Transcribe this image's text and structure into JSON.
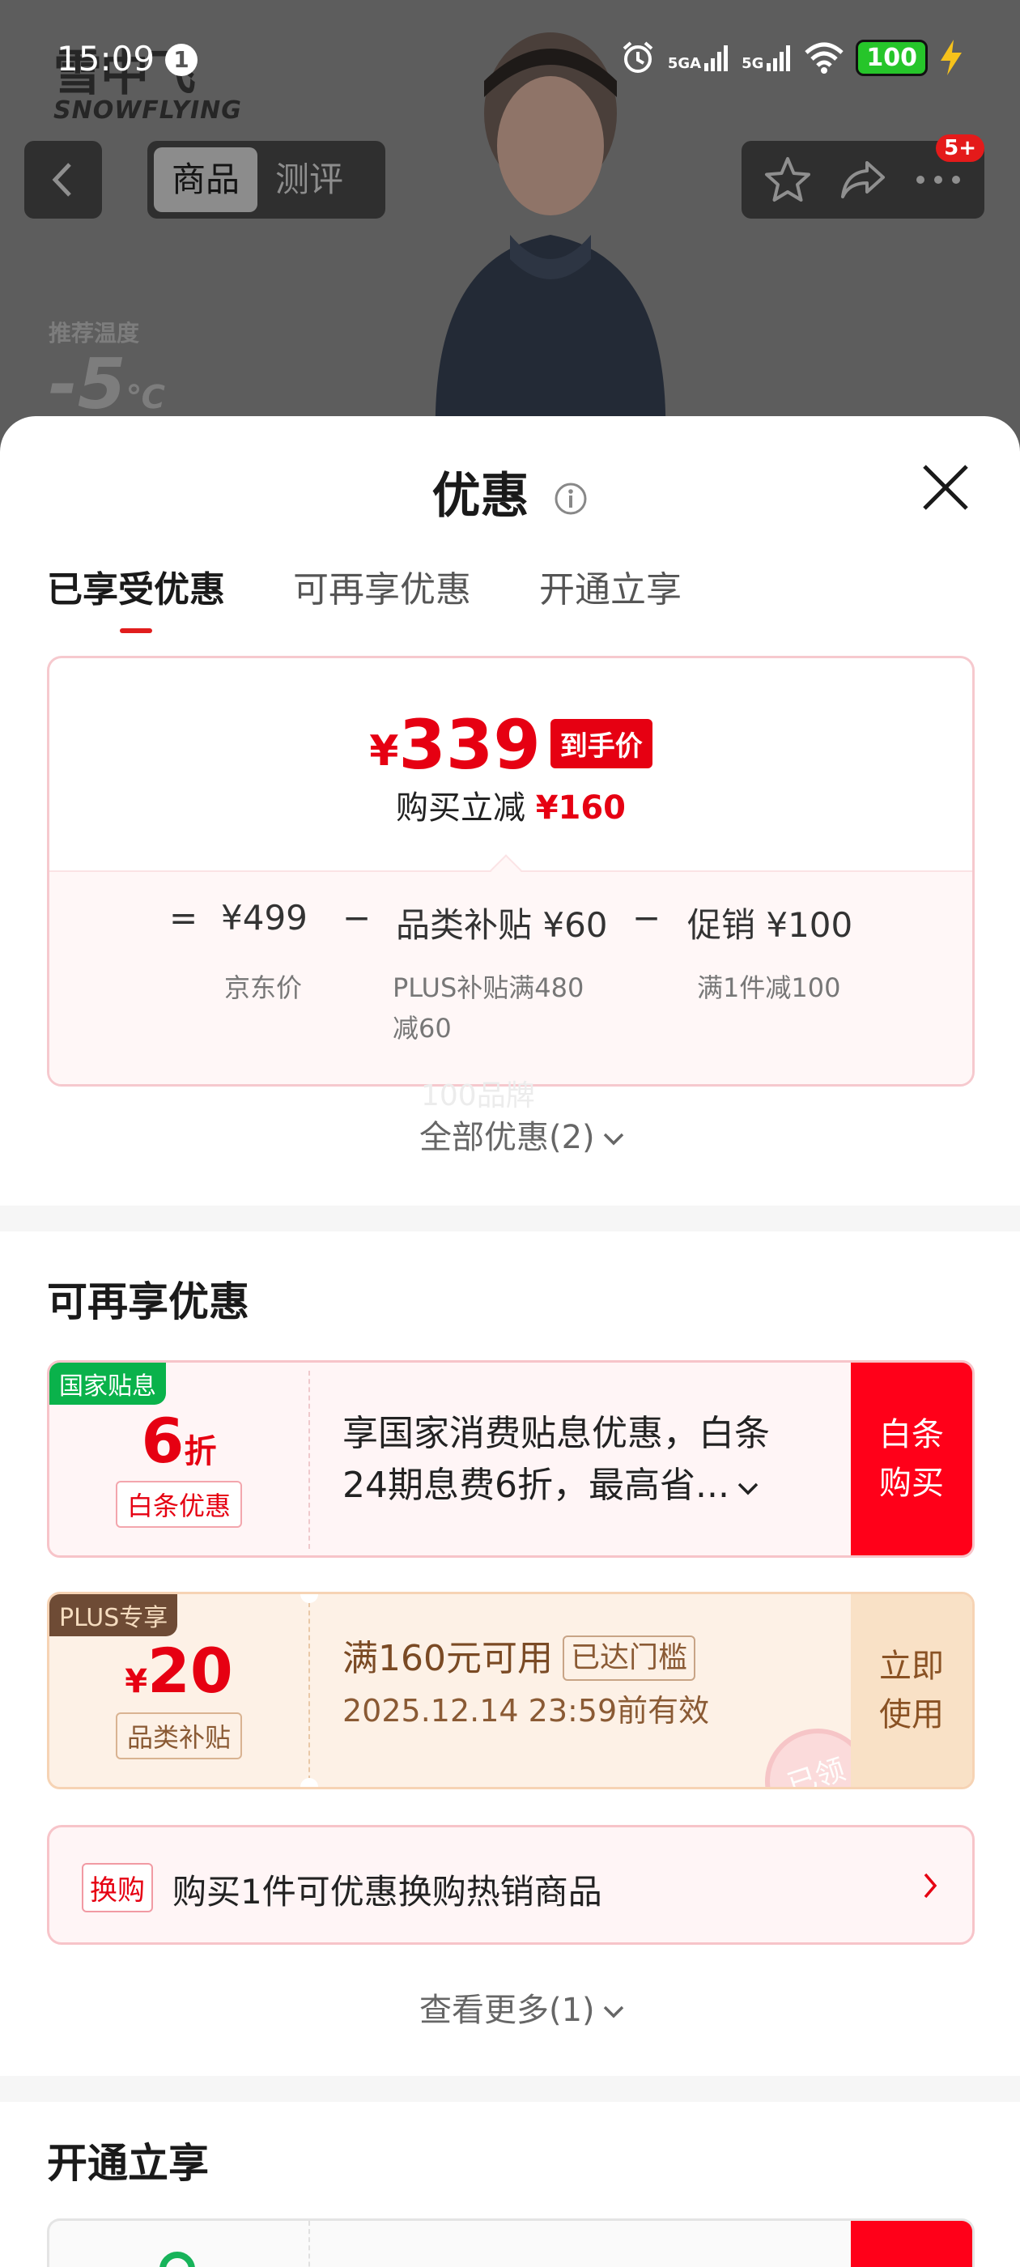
{
  "status_bar": {
    "time": "15:09",
    "notification_count": "1",
    "signal1_label": "5GA",
    "signal2_label": "5G",
    "battery": "100"
  },
  "background": {
    "brand_cn": "雪中飞",
    "brand_en": "SNOWFLYING",
    "temp_label": "推荐温度",
    "temp_value": "-5",
    "temp_unit": "℃"
  },
  "nav": {
    "tab_product": "商品",
    "tab_review": "测评",
    "more_badge": "5+"
  },
  "sheet": {
    "title": "优惠",
    "tabs": [
      "已享受优惠",
      "可再享优惠",
      "开通立享"
    ],
    "price_card": {
      "currency": "¥",
      "final_price": "339",
      "final_tag": "到手价",
      "reduce_label": "购买立减",
      "reduce_amount": "¥160",
      "eq": "=",
      "base_price": "¥499",
      "minus1": "−",
      "subsidy_label": "品类补贴 ¥60",
      "minus2": "−",
      "promo_label": "促销 ¥100",
      "base_desc": "京东价",
      "subsidy_desc_1": "PLUS补贴满480",
      "subsidy_desc_2": "减60",
      "promo_desc": "满1件减100"
    },
    "ghost_text": "100品牌",
    "all_discounts": "全部优惠(2)",
    "section_more": "可再享优惠",
    "coupon1": {
      "corner": "国家贴息",
      "big": "6",
      "big_unit": "折",
      "chip": "白条优惠",
      "line1": "享国家消费贴息优惠，白条",
      "line2": "24期息费6折，最高省...",
      "button_line1": "白条",
      "button_line2": "购买"
    },
    "coupon2": {
      "corner": "PLUS专享",
      "currency": "¥",
      "big": "20",
      "chip": "品类补贴",
      "line1": "满160元可用",
      "threshold": "已达门槛",
      "line2": "2025.12.14 23:59前有效",
      "stamp": "已领",
      "button_line1": "立即",
      "button_line2": "使用"
    },
    "exchange": {
      "tag": "换购",
      "text": "购买1件可优惠换购热销商品"
    },
    "view_more": "查看更多(1)",
    "section_open": "开通立享"
  },
  "colors": {
    "accent_red": "#e60012",
    "plus_brown": "#8a5224",
    "green_tag": "#0ab24b"
  }
}
